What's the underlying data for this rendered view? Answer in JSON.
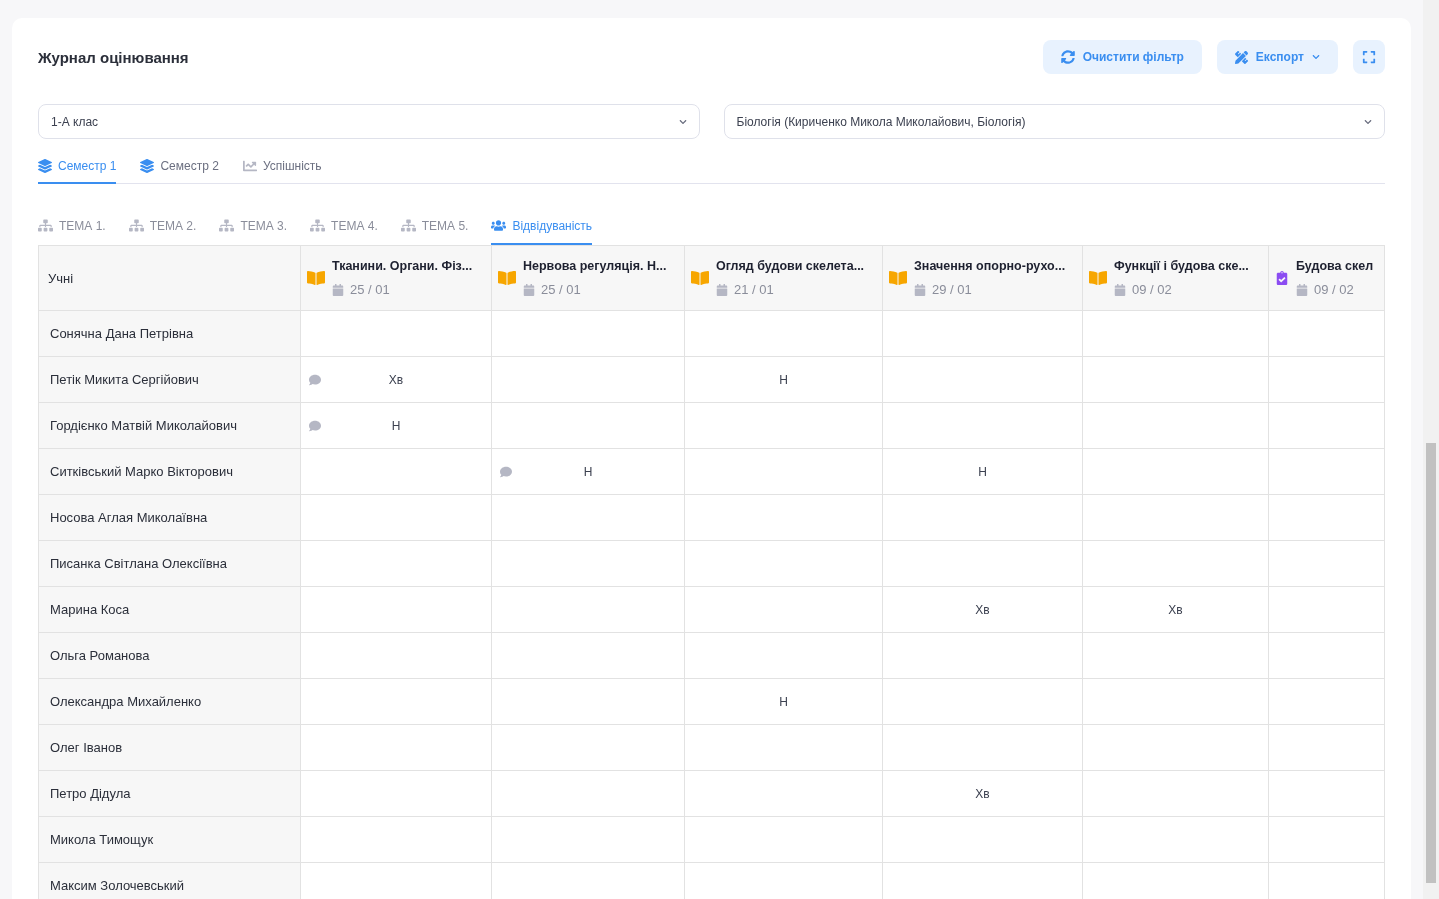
{
  "title": "Журнал оцінювання",
  "actions": [
    {
      "kind": "clear",
      "label": "Очистити фільтр"
    },
    {
      "kind": "export",
      "label": "Експорт"
    },
    {
      "kind": "fullscreen"
    }
  ],
  "filters": [
    {
      "value": "1-А клас"
    },
    {
      "value": "Біологія (Кириченко Микола Миколайович, Біологія)"
    }
  ],
  "tabs": [
    {
      "kind": "semester",
      "label": "Семестр 1",
      "selected": true
    },
    {
      "kind": "semester",
      "label": "Семестр 2",
      "selected": false
    },
    {
      "kind": "performance",
      "label": "Успішність",
      "selected": false
    }
  ],
  "subtabs": [
    {
      "kind": "topic",
      "label": "ТЕМА 1.",
      "selected": false
    },
    {
      "kind": "topic",
      "label": "ТЕМА 2.",
      "selected": false
    },
    {
      "kind": "topic",
      "label": "ТЕМА 3.",
      "selected": false
    },
    {
      "kind": "topic",
      "label": "ТЕМА 4.",
      "selected": false
    },
    {
      "kind": "topic",
      "label": "ТЕМА 5.",
      "selected": false
    },
    {
      "kind": "attendance",
      "label": "Відвідуваність",
      "selected": true
    }
  ],
  "table": {
    "first_column": "Учні",
    "columns": [
      {
        "kind": "lesson",
        "title": "Тканини. Органи. Фіз...",
        "date": "25 / 01"
      },
      {
        "kind": "lesson",
        "title": "Нервова регуляція. Н...",
        "date": "25 / 01"
      },
      {
        "kind": "lesson",
        "title": "Огляд будови скелета...",
        "date": "21 / 01"
      },
      {
        "kind": "lesson",
        "title": "Значення опорно-рухо...",
        "date": "29 / 01"
      },
      {
        "kind": "lesson",
        "title": "Функції і будова ске...",
        "date": "09 / 02"
      },
      {
        "kind": "test",
        "title": "Будова скел",
        "date": "09 / 02"
      }
    ],
    "rows": [
      {
        "name": "Сонячна Дана Петрівна",
        "cells": [
          {
            "comment": false
          },
          {
            "comment": false
          },
          {
            "comment": false
          },
          {
            "comment": false
          },
          {
            "comment": false
          },
          {
            "comment": false
          }
        ]
      },
      {
        "name": "Петік Микита Сергійович",
        "cells": [
          {
            "comment": true,
            "mark": "Хв"
          },
          {
            "comment": false
          },
          {
            "comment": false,
            "mark": "Н"
          },
          {
            "comment": false
          },
          {
            "comment": false
          },
          {
            "comment": false
          }
        ]
      },
      {
        "name": "Гордієнко Матвій Миколайович",
        "cells": [
          {
            "comment": true,
            "mark": "Н"
          },
          {
            "comment": false
          },
          {
            "comment": false
          },
          {
            "comment": false
          },
          {
            "comment": false
          },
          {
            "comment": false
          }
        ]
      },
      {
        "name": "Ситківський Марко Вікторович",
        "cells": [
          {
            "comment": false
          },
          {
            "comment": true,
            "mark": "Н"
          },
          {
            "comment": false
          },
          {
            "comment": false,
            "mark": "Н"
          },
          {
            "comment": false
          },
          {
            "comment": false
          }
        ]
      },
      {
        "name": "Носова Аглая Миколаївна",
        "cells": [
          {
            "comment": false
          },
          {
            "comment": false
          },
          {
            "comment": false
          },
          {
            "comment": false
          },
          {
            "comment": false
          },
          {
            "comment": false
          }
        ]
      },
      {
        "name": "Писанка Світлана Олексіївна",
        "cells": [
          {
            "comment": false
          },
          {
            "comment": false
          },
          {
            "comment": false
          },
          {
            "comment": false
          },
          {
            "comment": false
          },
          {
            "comment": false
          }
        ]
      },
      {
        "name": "Марина Коса",
        "cells": [
          {
            "comment": false
          },
          {
            "comment": false
          },
          {
            "comment": false
          },
          {
            "comment": false,
            "mark": "Хв"
          },
          {
            "comment": false,
            "mark": "Хв"
          },
          {
            "comment": false
          }
        ]
      },
      {
        "name": "Ольга Романова",
        "cells": [
          {
            "comment": false
          },
          {
            "comment": false
          },
          {
            "comment": false
          },
          {
            "comment": false
          },
          {
            "comment": false
          },
          {
            "comment": false
          }
        ]
      },
      {
        "name": "Олександра Михайленко",
        "cells": [
          {
            "comment": false
          },
          {
            "comment": false
          },
          {
            "comment": false,
            "mark": "Н"
          },
          {
            "comment": false
          },
          {
            "comment": false
          },
          {
            "comment": false
          }
        ]
      },
      {
        "name": "Олег Іванов",
        "cells": [
          {
            "comment": false
          },
          {
            "comment": false
          },
          {
            "comment": false
          },
          {
            "comment": false
          },
          {
            "comment": false
          },
          {
            "comment": false
          }
        ]
      },
      {
        "name": "Петро Дідула",
        "cells": [
          {
            "comment": false
          },
          {
            "comment": false
          },
          {
            "comment": false
          },
          {
            "comment": false,
            "mark": "Хв"
          },
          {
            "comment": false
          },
          {
            "comment": false
          }
        ]
      },
      {
        "name": "Микола Тимощук",
        "cells": [
          {
            "comment": false
          },
          {
            "comment": false
          },
          {
            "comment": false
          },
          {
            "comment": false
          },
          {
            "comment": false
          },
          {
            "comment": false
          }
        ]
      },
      {
        "name": "Максим Золочевський",
        "cells": [
          {
            "comment": false
          },
          {
            "comment": false
          },
          {
            "comment": false
          },
          {
            "comment": false
          },
          {
            "comment": false
          },
          {
            "comment": false
          }
        ]
      }
    ]
  }
}
